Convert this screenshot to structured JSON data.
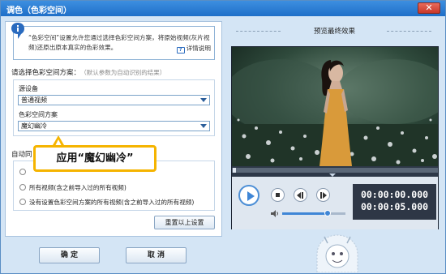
{
  "window": {
    "title": "调色（色彩空间）",
    "close_label": "✕"
  },
  "info": {
    "text": "“色彩空间”设置允许您通过选择色彩空间方案，将原始视频(灰片视频)还原出原本真实的色彩效果。",
    "help_label": "详情说明"
  },
  "scheme": {
    "label": "请选择色彩空间方案：",
    "hint": "（默认参数为自动识别的结果）",
    "source_label": "源设备",
    "source_value": "普通视频",
    "space_label": "色彩空间方案",
    "space_value": "魔幻幽冷"
  },
  "apply": {
    "label": "自动同",
    "options": [
      "",
      "所有视频(含之前导入过的所有视频)",
      "没有设置色彩空间方案的所有视频(含之前导入过的所有视频)"
    ],
    "reset_label": "重置以上设置"
  },
  "callout": {
    "text": "应用“魔幻幽冷”"
  },
  "buttons": {
    "ok": "确 定",
    "cancel": "取 消"
  },
  "preview": {
    "title": "预览最终效果",
    "time_current": "00:00:00.000",
    "time_total": "00:00:05.000",
    "progress": 0.0,
    "volume": 0.72
  },
  "colors": {
    "accent": "#3f86d6",
    "titlebar": "#1f6fc8",
    "highlight": "#f5b400"
  }
}
